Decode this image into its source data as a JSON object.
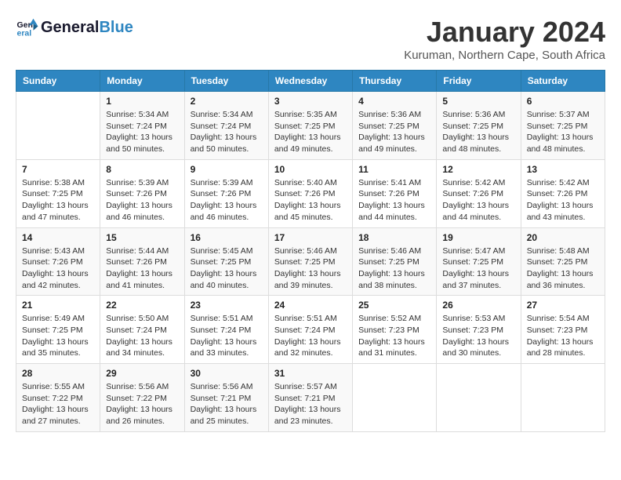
{
  "header": {
    "logo_general": "General",
    "logo_blue": "Blue",
    "month_title": "January 2024",
    "subtitle": "Kuruman, Northern Cape, South Africa"
  },
  "columns": [
    "Sunday",
    "Monday",
    "Tuesday",
    "Wednesday",
    "Thursday",
    "Friday",
    "Saturday"
  ],
  "weeks": [
    [
      {
        "day": "",
        "info": ""
      },
      {
        "day": "1",
        "info": "Sunrise: 5:34 AM\nSunset: 7:24 PM\nDaylight: 13 hours\nand 50 minutes."
      },
      {
        "day": "2",
        "info": "Sunrise: 5:34 AM\nSunset: 7:24 PM\nDaylight: 13 hours\nand 50 minutes."
      },
      {
        "day": "3",
        "info": "Sunrise: 5:35 AM\nSunset: 7:25 PM\nDaylight: 13 hours\nand 49 minutes."
      },
      {
        "day": "4",
        "info": "Sunrise: 5:36 AM\nSunset: 7:25 PM\nDaylight: 13 hours\nand 49 minutes."
      },
      {
        "day": "5",
        "info": "Sunrise: 5:36 AM\nSunset: 7:25 PM\nDaylight: 13 hours\nand 48 minutes."
      },
      {
        "day": "6",
        "info": "Sunrise: 5:37 AM\nSunset: 7:25 PM\nDaylight: 13 hours\nand 48 minutes."
      }
    ],
    [
      {
        "day": "7",
        "info": "Sunrise: 5:38 AM\nSunset: 7:25 PM\nDaylight: 13 hours\nand 47 minutes."
      },
      {
        "day": "8",
        "info": "Sunrise: 5:39 AM\nSunset: 7:26 PM\nDaylight: 13 hours\nand 46 minutes."
      },
      {
        "day": "9",
        "info": "Sunrise: 5:39 AM\nSunset: 7:26 PM\nDaylight: 13 hours\nand 46 minutes."
      },
      {
        "day": "10",
        "info": "Sunrise: 5:40 AM\nSunset: 7:26 PM\nDaylight: 13 hours\nand 45 minutes."
      },
      {
        "day": "11",
        "info": "Sunrise: 5:41 AM\nSunset: 7:26 PM\nDaylight: 13 hours\nand 44 minutes."
      },
      {
        "day": "12",
        "info": "Sunrise: 5:42 AM\nSunset: 7:26 PM\nDaylight: 13 hours\nand 44 minutes."
      },
      {
        "day": "13",
        "info": "Sunrise: 5:42 AM\nSunset: 7:26 PM\nDaylight: 13 hours\nand 43 minutes."
      }
    ],
    [
      {
        "day": "14",
        "info": "Sunrise: 5:43 AM\nSunset: 7:26 PM\nDaylight: 13 hours\nand 42 minutes."
      },
      {
        "day": "15",
        "info": "Sunrise: 5:44 AM\nSunset: 7:26 PM\nDaylight: 13 hours\nand 41 minutes."
      },
      {
        "day": "16",
        "info": "Sunrise: 5:45 AM\nSunset: 7:25 PM\nDaylight: 13 hours\nand 40 minutes."
      },
      {
        "day": "17",
        "info": "Sunrise: 5:46 AM\nSunset: 7:25 PM\nDaylight: 13 hours\nand 39 minutes."
      },
      {
        "day": "18",
        "info": "Sunrise: 5:46 AM\nSunset: 7:25 PM\nDaylight: 13 hours\nand 38 minutes."
      },
      {
        "day": "19",
        "info": "Sunrise: 5:47 AM\nSunset: 7:25 PM\nDaylight: 13 hours\nand 37 minutes."
      },
      {
        "day": "20",
        "info": "Sunrise: 5:48 AM\nSunset: 7:25 PM\nDaylight: 13 hours\nand 36 minutes."
      }
    ],
    [
      {
        "day": "21",
        "info": "Sunrise: 5:49 AM\nSunset: 7:25 PM\nDaylight: 13 hours\nand 35 minutes."
      },
      {
        "day": "22",
        "info": "Sunrise: 5:50 AM\nSunset: 7:24 PM\nDaylight: 13 hours\nand 34 minutes."
      },
      {
        "day": "23",
        "info": "Sunrise: 5:51 AM\nSunset: 7:24 PM\nDaylight: 13 hours\nand 33 minutes."
      },
      {
        "day": "24",
        "info": "Sunrise: 5:51 AM\nSunset: 7:24 PM\nDaylight: 13 hours\nand 32 minutes."
      },
      {
        "day": "25",
        "info": "Sunrise: 5:52 AM\nSunset: 7:23 PM\nDaylight: 13 hours\nand 31 minutes."
      },
      {
        "day": "26",
        "info": "Sunrise: 5:53 AM\nSunset: 7:23 PM\nDaylight: 13 hours\nand 30 minutes."
      },
      {
        "day": "27",
        "info": "Sunrise: 5:54 AM\nSunset: 7:23 PM\nDaylight: 13 hours\nand 28 minutes."
      }
    ],
    [
      {
        "day": "28",
        "info": "Sunrise: 5:55 AM\nSunset: 7:22 PM\nDaylight: 13 hours\nand 27 minutes."
      },
      {
        "day": "29",
        "info": "Sunrise: 5:56 AM\nSunset: 7:22 PM\nDaylight: 13 hours\nand 26 minutes."
      },
      {
        "day": "30",
        "info": "Sunrise: 5:56 AM\nSunset: 7:21 PM\nDaylight: 13 hours\nand 25 minutes."
      },
      {
        "day": "31",
        "info": "Sunrise: 5:57 AM\nSunset: 7:21 PM\nDaylight: 13 hours\nand 23 minutes."
      },
      {
        "day": "",
        "info": ""
      },
      {
        "day": "",
        "info": ""
      },
      {
        "day": "",
        "info": ""
      }
    ]
  ]
}
